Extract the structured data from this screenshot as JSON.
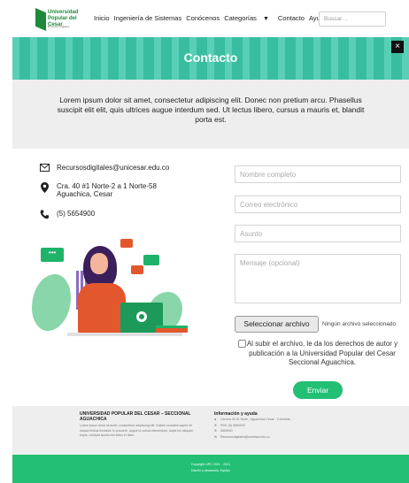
{
  "header": {
    "logo_line1": "Universidad",
    "logo_line2": "Popular del Cesar",
    "logo_sub": "Recursos digitales",
    "nav": [
      "Inicio",
      "Ingeniería de Sistemas",
      "Conócenos",
      "Categorías",
      "Contacto",
      "Ayuda"
    ],
    "search_placeholder": "Buscar ..."
  },
  "hero": {
    "title": "Contacto",
    "close": "×"
  },
  "intro": {
    "text": "Lorem ipsum dolor sit amet, consectetur adipiscing elit. Donec non pretium arcu. Phasellus suscipit elit elit, quis ultrices augue interdum sed. Ut lectus libero, cursus a mauris et, blandit porta est."
  },
  "contact": {
    "email": "Recursosdigitales@unicesar.edu.co",
    "address_line1": "Cra. 40 #1 Norte-2 a 1 Norte-58",
    "address_line2": "Aguachica, Cesar",
    "phone": "(5) 5654900"
  },
  "illustration": {
    "bubble_text": "•••"
  },
  "form": {
    "name_placeholder": "Nombre completo",
    "email_placeholder": "Correo electrónico",
    "subject_placeholder": "Asunto",
    "message_placeholder": "Mensaje (opcional)",
    "file_button": "Seleccionar archivo",
    "file_status": "Ningún archivo seleccionado",
    "consent": "Al subir el archivo, le da los derechos de autor y publicación a la Universidad Popular del Cesar Seccional Aguachica.",
    "submit": "Enviar"
  },
  "footer": {
    "org_title": "UNIVERSIDAD POPULAR DEL CESAR – SECCIONAL AGUACHICA",
    "org_text": "Lorem ipsum dolor sit amet, consectetur adipiscing elit. Nullam convallis sapien et massa finibus tincidunt. In posuere, augue id cursus elementum, turpis leo aliquam turpis, volutpat iaculis nisi tellus et diam.",
    "info_title": "Información y ayuda",
    "info_address": "Carrera 40 #1 Norte - Aguachica Cesar - Colombia",
    "info_pbx": "PBX: (5) 5654900",
    "info_phone": "5654900",
    "info_email": "Recursosdigitales@unicesar.edu.co",
    "copyright": "Copyright UPC 2021 · 2021",
    "credits": "Diseño y desarrollo: Equipo"
  },
  "colors": {
    "green": "#22bf74",
    "teal": "#3cc7a8",
    "gray": "#eeeeee"
  }
}
